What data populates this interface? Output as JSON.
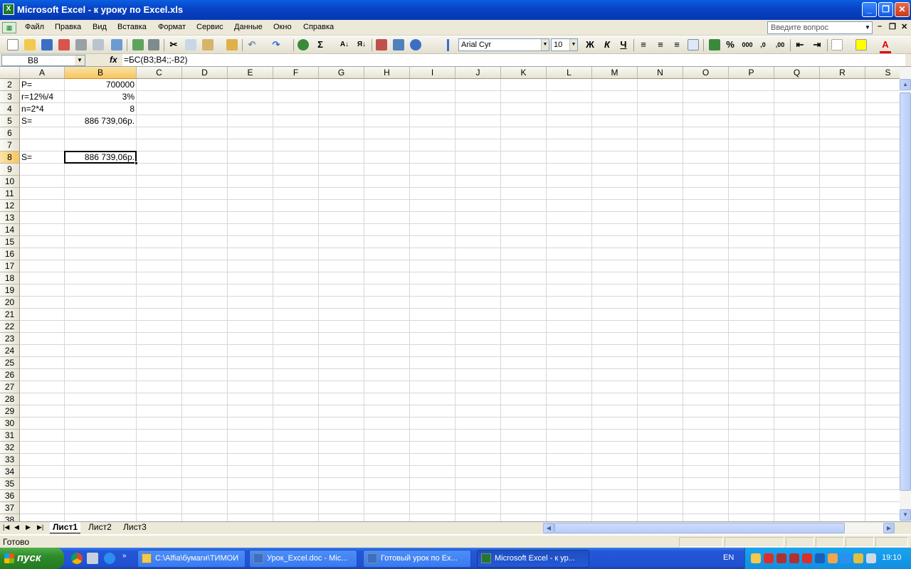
{
  "window": {
    "title": "Microsoft Excel - к уроку по Excel.xls",
    "app_icon": "excel-icon"
  },
  "menu": {
    "items": [
      "Файл",
      "Правка",
      "Вид",
      "Вставка",
      "Формат",
      "Сервис",
      "Данные",
      "Окно",
      "Справка"
    ],
    "help_placeholder": "Введите вопрос"
  },
  "toolbar": {
    "font_name": "Arial Cyr",
    "font_size": "10",
    "bold": "Ж",
    "italic": "К",
    "underline": "Ч",
    "percent": "%",
    "thousands": "000",
    "sigma": "Σ"
  },
  "formula_bar": {
    "name_box": "B8",
    "fx": "fx",
    "formula": "=БС(B3;B4;;-B2)"
  },
  "grid": {
    "columns": [
      "A",
      "B",
      "C",
      "D",
      "E",
      "F",
      "G",
      "H",
      "I",
      "J",
      "K",
      "L",
      "M",
      "N",
      "O",
      "P",
      "Q",
      "R",
      "S"
    ],
    "rows": [
      "2",
      "3",
      "4",
      "5",
      "6",
      "7",
      "8",
      "9",
      "10",
      "11",
      "12",
      "13",
      "14",
      "15",
      "16",
      "17",
      "18",
      "19",
      "20",
      "21",
      "22",
      "23",
      "24",
      "25",
      "26",
      "27",
      "28",
      "29",
      "30",
      "31",
      "32",
      "33",
      "34",
      "35",
      "36",
      "37",
      "38"
    ],
    "selected_cell": "B8",
    "cells": [
      {
        "row": "2",
        "a": "P=",
        "b": "700000"
      },
      {
        "row": "3",
        "a": "r=12%/4",
        "b": "3%"
      },
      {
        "row": "4",
        "a": "n=2*4",
        "b": "8"
      },
      {
        "row": "5",
        "a": "S=",
        "b": "886 739,06р."
      },
      {
        "row": "8",
        "a": "S=",
        "b": "886 739,06р."
      }
    ]
  },
  "sheets": {
    "tabs": [
      "Лист1",
      "Лист2",
      "Лист3"
    ],
    "active": "Лист1"
  },
  "status": {
    "text": "Готово"
  },
  "taskbar": {
    "start_label": "пуск",
    "buttons": [
      "C:\\Alfia\\бумаги\\ТИМОИ",
      "Урок_Excel.doc - Mic...",
      "Готовый урок по Ex...",
      "Microsoft Excel - к ур..."
    ],
    "active_button": "Microsoft Excel - к ур...",
    "lang": "EN",
    "clock": "19:10"
  },
  "colors": {
    "title_blue": "#0a5fe0",
    "selected_header": "#f6c560",
    "taskbar_blue": "#2458d8",
    "start_green": "#2e8a2a"
  }
}
